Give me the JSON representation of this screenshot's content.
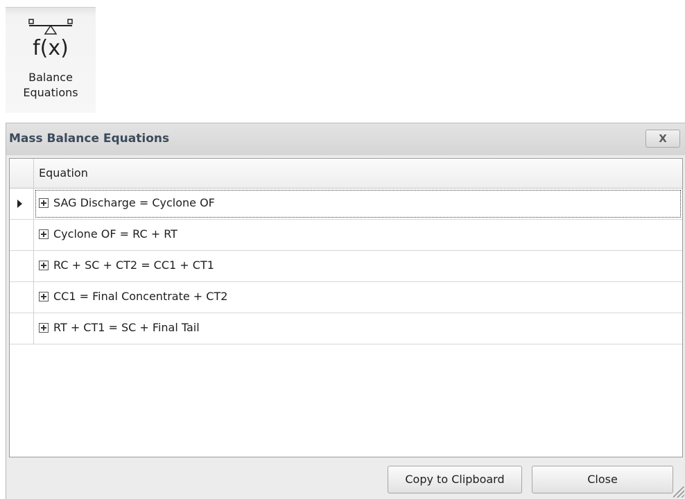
{
  "ribbon": {
    "button_label_line1": "Balance",
    "button_label_line2": "Equations",
    "icon": "balance-equation-icon"
  },
  "dialog": {
    "title": "Mass Balance Equations",
    "close_glyph": "X",
    "grid": {
      "column_header": "Equation",
      "rows": [
        {
          "equation": "SAG Discharge = Cyclone OF",
          "selected": true
        },
        {
          "equation": "Cyclone OF = RC + RT",
          "selected": false
        },
        {
          "equation": "RC + SC + CT2 = CC1 + CT1",
          "selected": false
        },
        {
          "equation": "CC1 = Final Concentrate + CT2",
          "selected": false
        },
        {
          "equation": "RT + CT1 = SC + Final Tail",
          "selected": false
        }
      ]
    },
    "buttons": {
      "copy_label": "Copy to Clipboard",
      "close_label": "Close"
    }
  }
}
